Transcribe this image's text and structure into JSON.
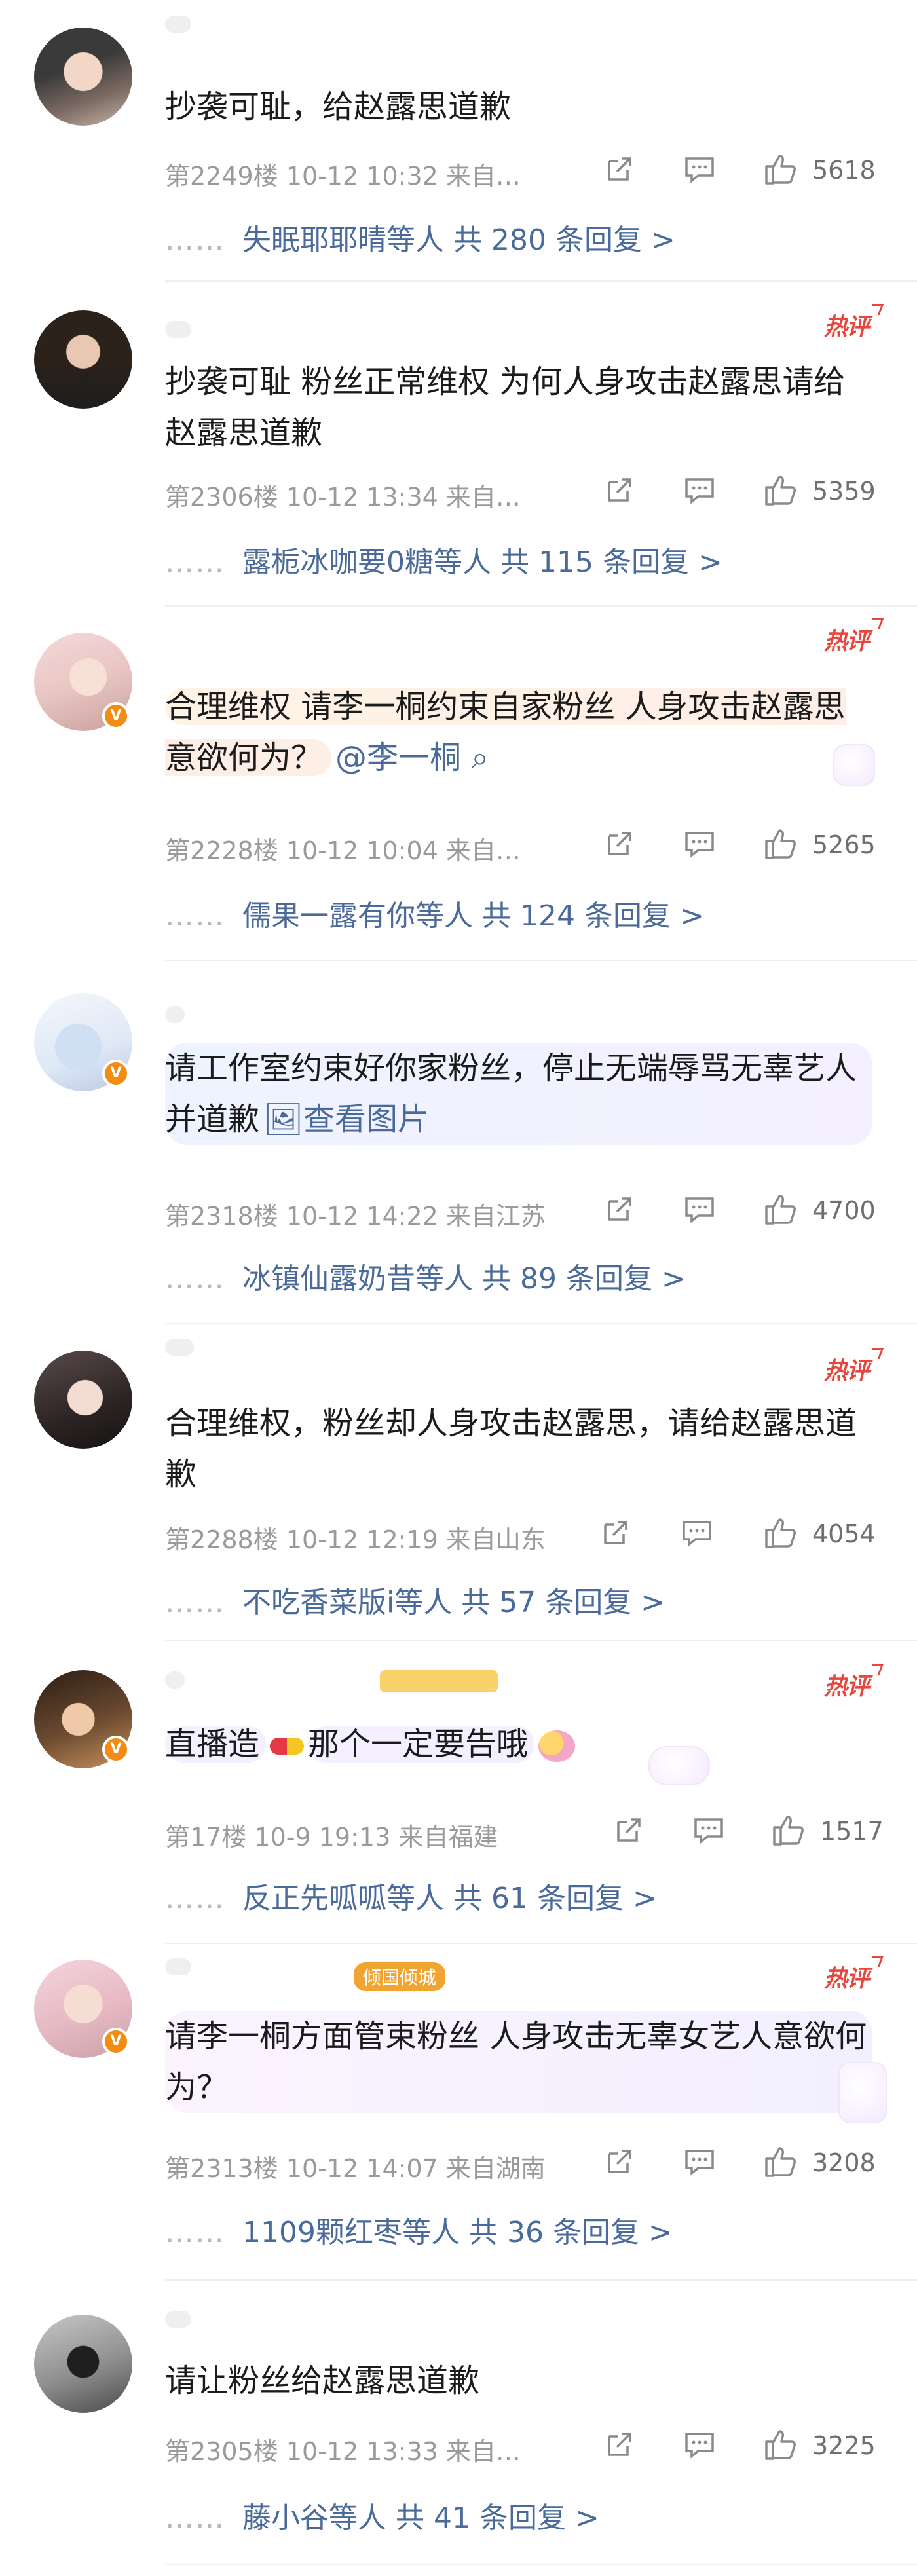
{
  "comments": [
    {
      "text": "抄袭可耻，给赵露思道歉",
      "floor": "第2249楼  10-12 10:32  来自…",
      "likes": "5618",
      "reply_user": "失眠耶耶晴等人",
      "reply_count": "共 280 条回复 >"
    },
    {
      "hot_badge": "热评",
      "text": "抄袭可耻 粉丝正常维权 为何人身攻击赵露思请给赵露思道歉",
      "floor": "第2306楼  10-12 13:34  来自…",
      "likes": "5359",
      "reply_user": "露栀冰咖要0糖等人",
      "reply_count": "共 115 条回复 >"
    },
    {
      "hot_badge": "热评",
      "text": "合理维权 请李一桐约束自家粉丝 人身攻击赵露思意欲何为？",
      "mention": "@李一桐",
      "floor": "第2228楼  10-12 10:04  来自…",
      "likes": "5265",
      "reply_user": "儒果一露有你等人",
      "reply_count": "共 124 条回复 >"
    },
    {
      "text": "请工作室约束好你家粉丝，停止无端辱骂无辜艺人并道歉",
      "link": "查看图片",
      "floor": "第2318楼  10-12 14:22  来自江苏",
      "likes": "4700",
      "reply_user": "冰镇仙露奶昔等人",
      "reply_count": "共 89 条回复 >"
    },
    {
      "hot_badge": "热评",
      "text": "合理维权，粉丝却人身攻击赵露思，请给赵露思道歉",
      "floor": "第2288楼  10-12 12:19  来自山东",
      "likes": "4054",
      "reply_user": "不吃香菜版i等人",
      "reply_count": "共 57 条回复 >"
    },
    {
      "hot_badge": "热评",
      "text_a": "直播造",
      "text_b": "那个一定要告哦",
      "floor": "第17楼  10-9 19:13  来自福建",
      "likes": "1517",
      "reply_user": "反正先呱呱等人",
      "reply_count": "共 61 条回复 >"
    },
    {
      "hot_badge": "热评",
      "fan_badge": "倾国倾城",
      "text": "请李一桐方面管束粉丝 人身攻击无辜女艺人意欲何为？",
      "floor": "第2313楼  10-12 14:07  来自湖南",
      "likes": "3208",
      "reply_user": "1109颗红枣等人",
      "reply_count": "共 36 条回复 >"
    },
    {
      "text": "请让粉丝给赵露思道歉",
      "floor": "第2305楼  10-12 13:33  来自…",
      "likes": "3225",
      "reply_user": "藤小谷等人",
      "reply_count": "共 41 条回复 >"
    }
  ],
  "dots": "……",
  "colors": {
    "link": "#4a6a9a",
    "hot": "#e8453c",
    "meta": "#9a9a9a",
    "vip": "#f38c10"
  }
}
